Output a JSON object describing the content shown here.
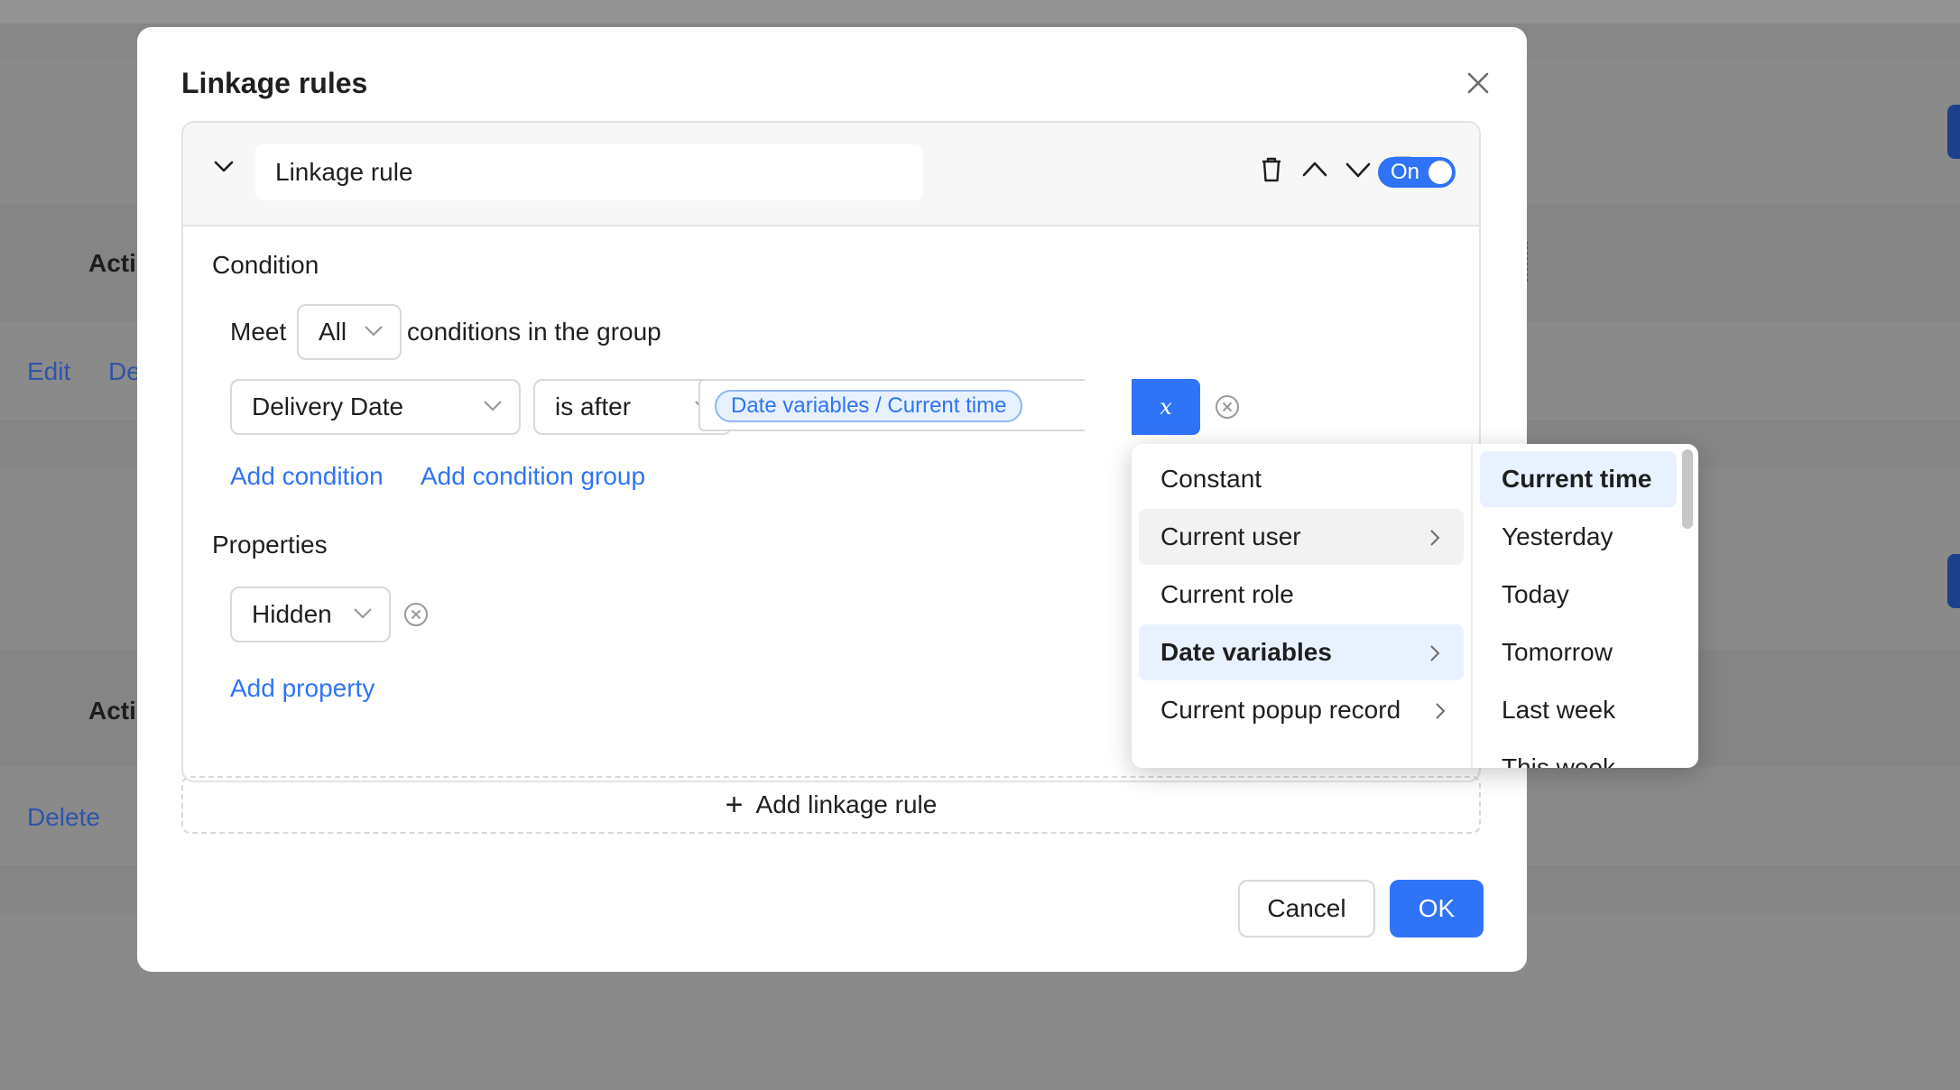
{
  "background": {
    "section1_header": "Acti",
    "row1_actions": [
      "Edit",
      "De"
    ],
    "section2_header": "Acti",
    "row2_actions": [
      "Delete"
    ]
  },
  "modal": {
    "title": "Linkage rules",
    "rule": {
      "name": "Linkage rule",
      "toggle_label": "On",
      "condition_label": "Condition",
      "meet_prefix": "Meet",
      "meet_value": "All",
      "meet_suffix": "conditions in the group",
      "field": "Delivery Date",
      "operator": "is after",
      "value_tag": "Date variables / Current time",
      "variable_button": "x",
      "add_condition": "Add condition",
      "add_condition_group": "Add condition group",
      "properties_label": "Properties",
      "property_value": "Hidden",
      "add_property": "Add property"
    },
    "add_rule": "Add linkage rule",
    "cancel": "Cancel",
    "ok": "OK"
  },
  "cascader": {
    "level1": [
      {
        "label": "Constant",
        "has_children": false
      },
      {
        "label": "Current user",
        "has_children": true
      },
      {
        "label": "Current role",
        "has_children": false
      },
      {
        "label": "Date variables",
        "has_children": true
      },
      {
        "label": "Current popup record",
        "has_children": true
      }
    ],
    "level2": [
      "Current time",
      "Yesterday",
      "Today",
      "Tomorrow",
      "Last week",
      "This week"
    ]
  },
  "colors": {
    "accent": "#2f74f6",
    "tag_bg": "#e8f1ff",
    "overlay": "#8a8a8a"
  }
}
